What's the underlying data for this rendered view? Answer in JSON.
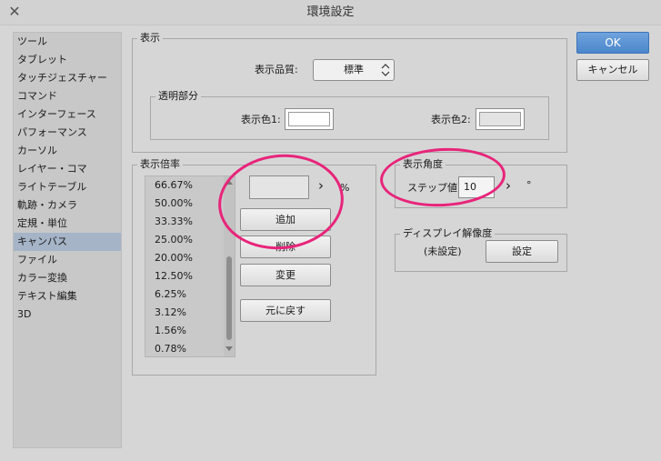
{
  "window": {
    "title": "環境設定",
    "close_glyph": "✕"
  },
  "sidebar": {
    "items": [
      {
        "label": "ツール"
      },
      {
        "label": "タブレット"
      },
      {
        "label": "タッチジェスチャー"
      },
      {
        "label": "コマンド"
      },
      {
        "label": "インターフェース"
      },
      {
        "label": "パフォーマンス"
      },
      {
        "label": "カーソル"
      },
      {
        "label": "レイヤー・コマ"
      },
      {
        "label": "ライトテーブル"
      },
      {
        "label": "軌跡・カメラ"
      },
      {
        "label": "定規・単位"
      },
      {
        "label": "キャンバス"
      },
      {
        "label": "ファイル"
      },
      {
        "label": "カラー変換"
      },
      {
        "label": "テキスト編集"
      },
      {
        "label": "3D"
      }
    ],
    "selected": "キャンバス"
  },
  "buttons": {
    "ok": "OK",
    "cancel": "キャンセル"
  },
  "display": {
    "group_label": "表示",
    "quality_label": "表示品質:",
    "quality_value": "標準",
    "transparent_group": "透明部分",
    "color1_label": "表示色1:",
    "color2_label": "表示色2:",
    "color1": "#ffffff",
    "color2": "#e3e3e3"
  },
  "zoom": {
    "group_label": "表示倍率",
    "values": [
      "66.67%",
      "50.00%",
      "33.33%",
      "25.00%",
      "20.00%",
      "12.50%",
      "6.25%",
      "3.12%",
      "1.56%",
      "0.78%"
    ],
    "input_value": "",
    "arrow": "›",
    "unit": "%",
    "add": "追加",
    "delete": "削除",
    "change": "変更",
    "reset": "元に戻す"
  },
  "angle": {
    "group_label": "表示角度",
    "step_label": "ステップ値:",
    "step_value": "10",
    "arrow": "›",
    "unit": "°"
  },
  "resolution": {
    "group_label": "ディスプレイ解像度",
    "status": "(未設定)",
    "button": "設定"
  },
  "colors": {
    "accent": "#4c86cb",
    "highlight": "#e8247a",
    "selection": "#a5b4c7"
  }
}
